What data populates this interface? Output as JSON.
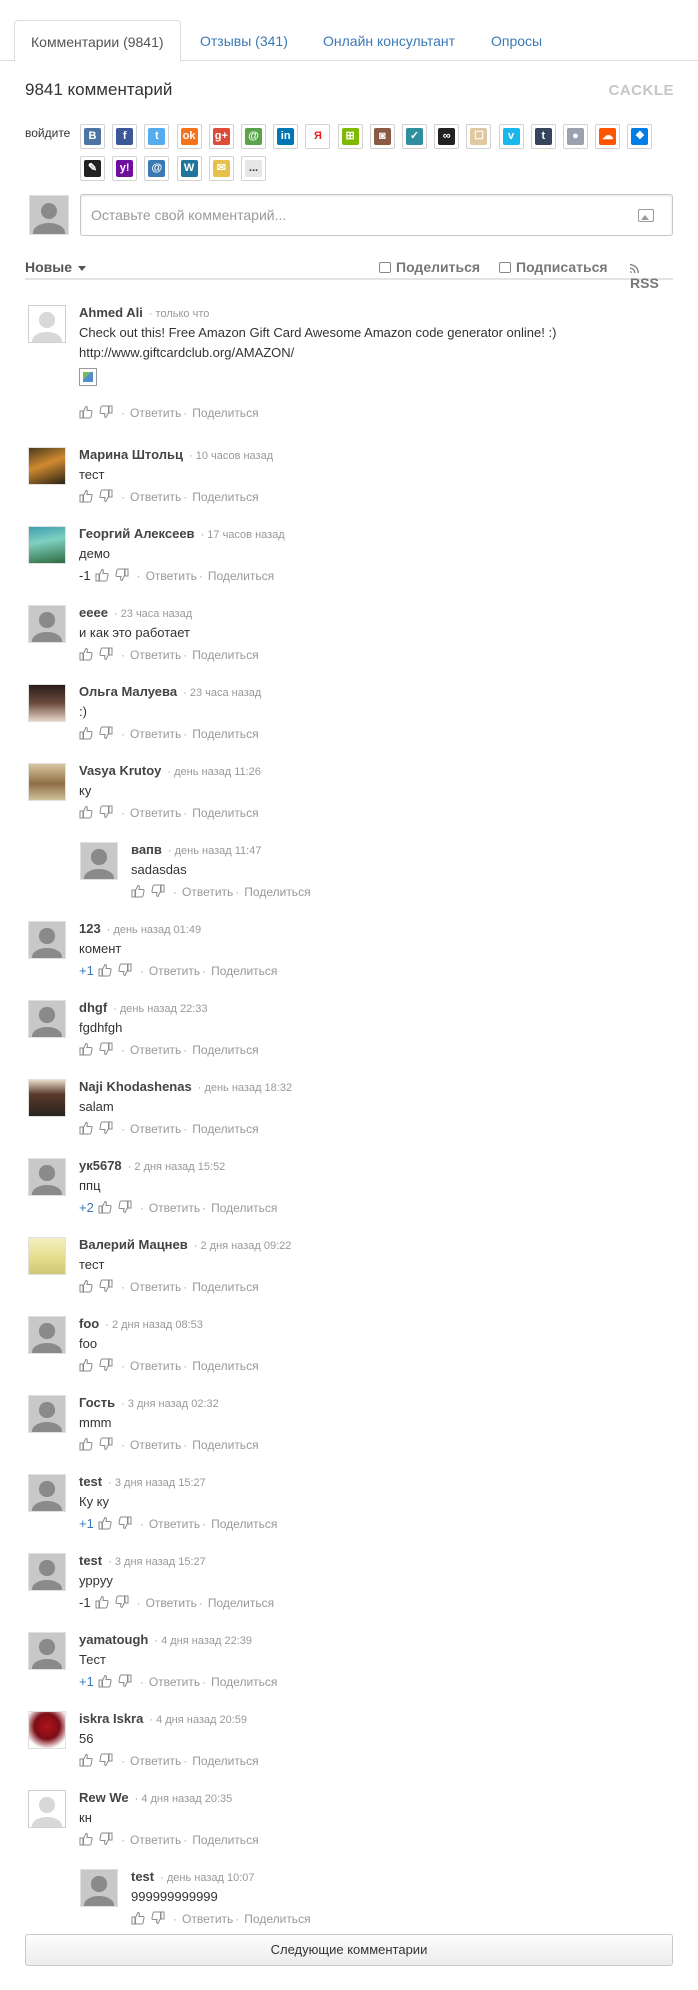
{
  "tabs": [
    {
      "label": "Комментарии (9841)",
      "active": true
    },
    {
      "label": "Отзывы (341)"
    },
    {
      "label": "Онлайн консультант"
    },
    {
      "label": "Опросы"
    }
  ],
  "header": {
    "count_title": "9841 комментарий",
    "logo": "CACKLE"
  },
  "login": {
    "label": "войдите",
    "providers": [
      {
        "name": "vkontakte-icon",
        "color": "#4c75a3",
        "glyph": "B"
      },
      {
        "name": "facebook-icon",
        "color": "#3b5998",
        "glyph": "f"
      },
      {
        "name": "twitter-icon",
        "color": "#55acee",
        "glyph": "t"
      },
      {
        "name": "odnoklassniki-icon",
        "color": "#f4731c",
        "glyph": "ok"
      },
      {
        "name": "google-plus-icon",
        "color": "#dd4b39",
        "glyph": "g+"
      },
      {
        "name": "mailru-icon",
        "color": "#5aa34b",
        "glyph": "@"
      },
      {
        "name": "linkedin-icon",
        "color": "#0077b5",
        "glyph": "in"
      },
      {
        "name": "yandex-icon",
        "color": "#ffffff",
        "glyph": "Я"
      },
      {
        "name": "microsoft-icon",
        "color": "#7fba00",
        "glyph": "⊞"
      },
      {
        "name": "instagram-icon",
        "color": "#8a5a44",
        "glyph": "◙"
      },
      {
        "name": "livejournal-icon",
        "color": "#2f8f9d",
        "glyph": "✓"
      },
      {
        "name": "lastfm-icon",
        "color": "#222222",
        "glyph": "∞"
      },
      {
        "name": "liveinternet-icon",
        "color": "#e0c8a0",
        "glyph": "☐"
      },
      {
        "name": "vimeo-icon",
        "color": "#1ab7ea",
        "glyph": "v"
      },
      {
        "name": "tumblr-icon",
        "color": "#35465c",
        "glyph": "t"
      },
      {
        "name": "anonymous-icon",
        "color": "#9aa3ad",
        "glyph": "●"
      },
      {
        "name": "soundcloud-icon",
        "color": "#ff5500",
        "glyph": "☁"
      },
      {
        "name": "dropbox-icon",
        "color": "#007ee5",
        "glyph": "❖"
      },
      {
        "name": "paperclip-icon",
        "color": "#222222",
        "glyph": "✎"
      },
      {
        "name": "yahoo-icon",
        "color": "#720e9e",
        "glyph": "y!"
      },
      {
        "name": "email-icon",
        "color": "#3a79b5",
        "glyph": "@"
      },
      {
        "name": "wordpress-icon",
        "color": "#21759b",
        "glyph": "W"
      },
      {
        "name": "chat-icon",
        "color": "#e6c04a",
        "glyph": "✉"
      },
      {
        "name": "more-icon",
        "color": "#666666",
        "glyph": "..."
      }
    ]
  },
  "composer": {
    "placeholder": "Оставьте свой комментарий..."
  },
  "toolbar": {
    "sort_label": "Новые",
    "share_label": "Поделиться",
    "subscribe_label": "Подписаться",
    "rss_label": "RSS"
  },
  "actions": {
    "reply_label": "Ответить",
    "share_label": "Поделиться"
  },
  "comments": [
    {
      "author": "Ahmed Ali",
      "time": "только что",
      "text": "Check out this! Free Amazon Gift Card Awesome Amazon code generator online! :)",
      "text2": " http://www.giftcardclub.org/AMAZON/",
      "avatar": "ph-white"
    },
    {
      "author": "Марина Штольц",
      "time": "10 часов назад",
      "text": "тест",
      "avatar": "photo-dark"
    },
    {
      "author": "Георгий Алексеев",
      "time": "17 часов назад",
      "text": "демо",
      "score": "-1",
      "avatar": "photo-green"
    },
    {
      "author": "eeee",
      "time": "23 часа назад",
      "text": "и как это работает",
      "avatar": "ph"
    },
    {
      "author": "Ольга Малуева",
      "time": "23 часа назад",
      "text": ":)",
      "avatar": "photo-woman"
    },
    {
      "author": "Vasya Krutoy",
      "time": "день назад 11:26",
      "text": "ку",
      "avatar": "photo-sepia"
    },
    {
      "author": "вапв",
      "time": "день назад 11:47",
      "text": "sadasdas",
      "avatar": "ph",
      "reply": true
    },
    {
      "author": "123",
      "time": "день назад 01:49",
      "text": "комент",
      "score": "+1",
      "avatar": "ph"
    },
    {
      "author": "dhgf",
      "time": "день назад 22:33",
      "text": "fgdhfgh",
      "avatar": "ph"
    },
    {
      "author": "Naji Khodashenas",
      "time": "день назад 18:32",
      "text": "salam",
      "avatar": "photo-man"
    },
    {
      "author": "ук5678",
      "time": "2 дня назад 15:52",
      "text": "ппц",
      "score": "+2",
      "avatar": "ph"
    },
    {
      "author": "Валерий Мацнев",
      "time": "2 дня назад 09:22",
      "text": "тест",
      "avatar": "photo-yellow"
    },
    {
      "author": "foo",
      "time": "2 дня назад 08:53",
      "text": "foo",
      "avatar": "ph"
    },
    {
      "author": "Гость",
      "time": "3 дня назад 02:32",
      "text": "mmm",
      "avatar": "ph"
    },
    {
      "author": "test",
      "time": "3 дня назад 15:27",
      "text": "Ку ку",
      "score": "+1",
      "avatar": "ph"
    },
    {
      "author": "test",
      "time": "3 дня назад 15:27",
      "text": "уррyy",
      "score": "-1",
      "avatar": "ph"
    },
    {
      "author": "yamatough",
      "time": "4 дня назад 22:39",
      "text": "Тест",
      "score": "+1",
      "avatar": "ph"
    },
    {
      "author": "iskra Iskra",
      "time": "4 дня назад 20:59",
      "text": "56",
      "avatar": "photo-roses"
    },
    {
      "author": "Rew We",
      "time": "4 дня назад 20:35",
      "text": "кн",
      "avatar": "ph-white"
    },
    {
      "author": "test",
      "time": "день назад 10:07",
      "text": "999999999999",
      "avatar": "ph",
      "reply": true
    }
  ],
  "footer": {
    "next_label": "Следующие комментарии"
  }
}
